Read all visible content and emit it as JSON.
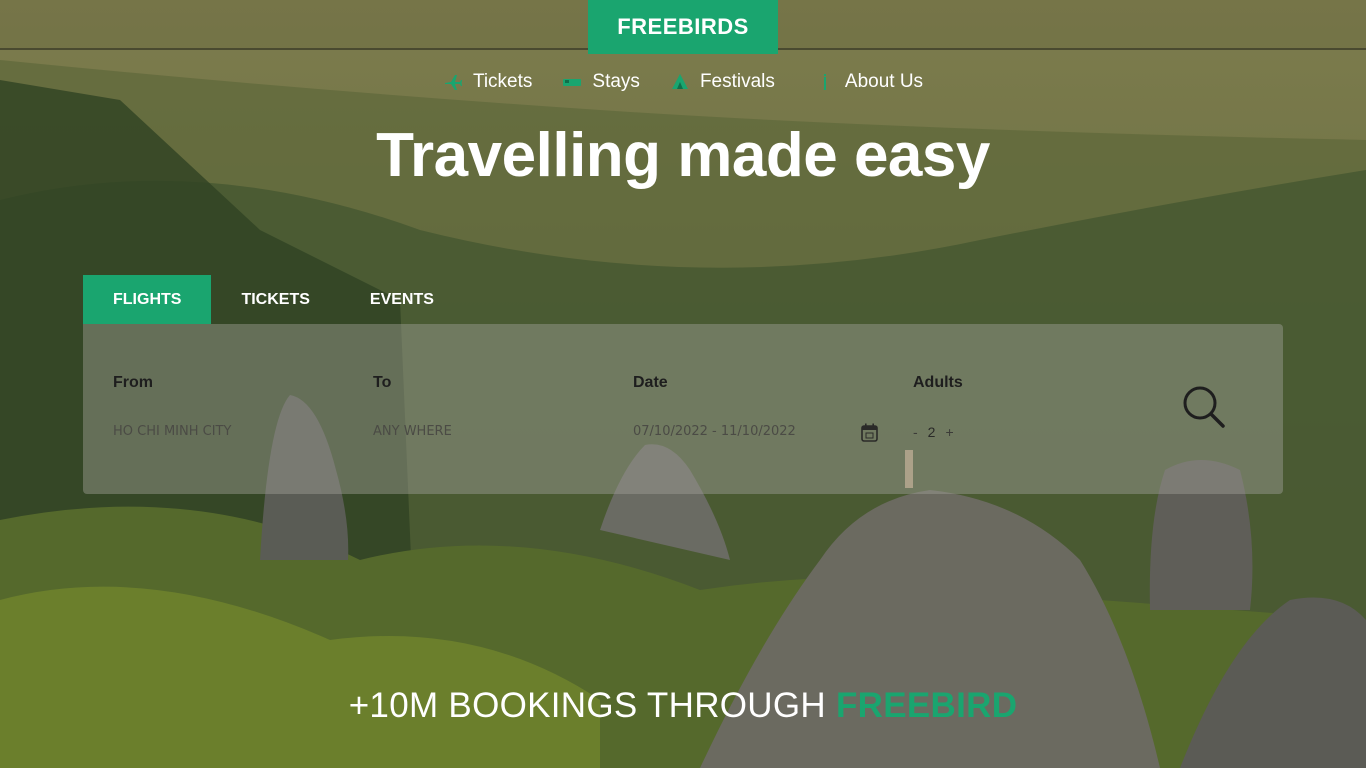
{
  "brand": "FREEBIRDS",
  "nav": {
    "items": [
      {
        "label": "Tickets",
        "icon": "plane-icon"
      },
      {
        "label": "Stays",
        "icon": "bed-icon"
      },
      {
        "label": "Festivals",
        "icon": "tent-icon"
      },
      {
        "label": "About Us",
        "icon": "info-icon"
      }
    ]
  },
  "hero": {
    "title": "Travelling made easy"
  },
  "tabs": [
    {
      "label": "FLIGHTS",
      "active": true
    },
    {
      "label": "TICKETS",
      "active": false
    },
    {
      "label": "EVENTS",
      "active": false
    }
  ],
  "search": {
    "from": {
      "label": "From",
      "value": "HO CHI MINH CITY"
    },
    "to": {
      "label": "To",
      "value": "ANY WHERE"
    },
    "date": {
      "label": "Date",
      "value": "07/10/2022 - 11/10/2022",
      "icon": "calendar-icon"
    },
    "adults": {
      "label": "Adults",
      "minus": "-",
      "count": "2",
      "plus": "+"
    },
    "button_icon": "search-icon"
  },
  "footer": {
    "prefix": "+10M BOOKINGS THROUGH ",
    "accent": "FREEBIRD"
  },
  "colors": {
    "accent": "#1aa56f",
    "panel": "rgba(160,160,150,0.45)",
    "text_light": "#ffffff"
  }
}
